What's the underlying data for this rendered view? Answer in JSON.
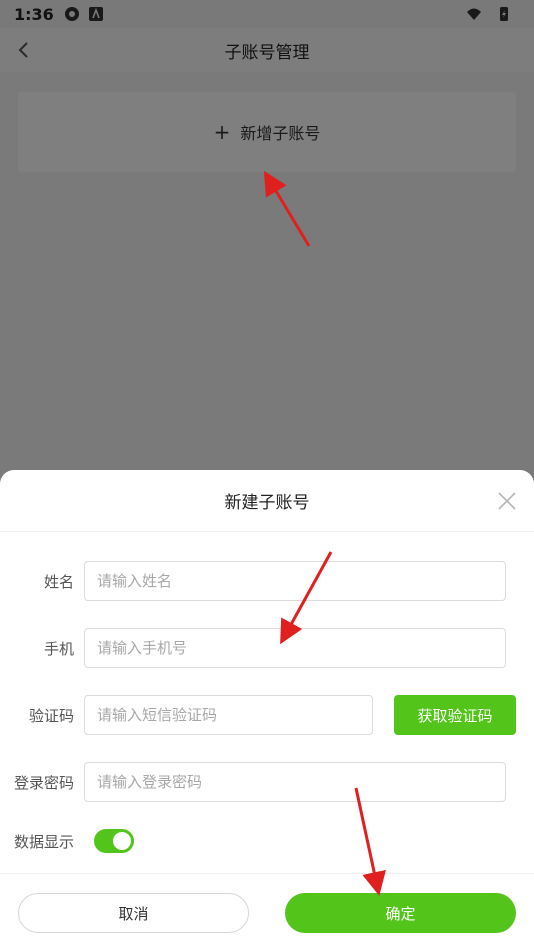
{
  "status_bar": {
    "time": "1:36"
  },
  "header": {
    "title": "子账号管理"
  },
  "add_card": {
    "plus": "+",
    "label": "新增子账号"
  },
  "sheet": {
    "title": "新建子账号",
    "fields": {
      "name": {
        "label": "姓名",
        "placeholder": "请输入姓名"
      },
      "phone": {
        "label": "手机",
        "placeholder": "请输入手机号"
      },
      "code": {
        "label": "验证码",
        "placeholder": "请输入短信验证码",
        "button": "获取验证码"
      },
      "password": {
        "label": "登录密码",
        "placeholder": "请输入登录密码"
      },
      "data_display": {
        "label": "数据显示",
        "on": true
      }
    },
    "cancel_label": "取消",
    "confirm_label": "确定"
  },
  "colors": {
    "accent": "#52c41a",
    "annotation": "#e01f1f"
  }
}
